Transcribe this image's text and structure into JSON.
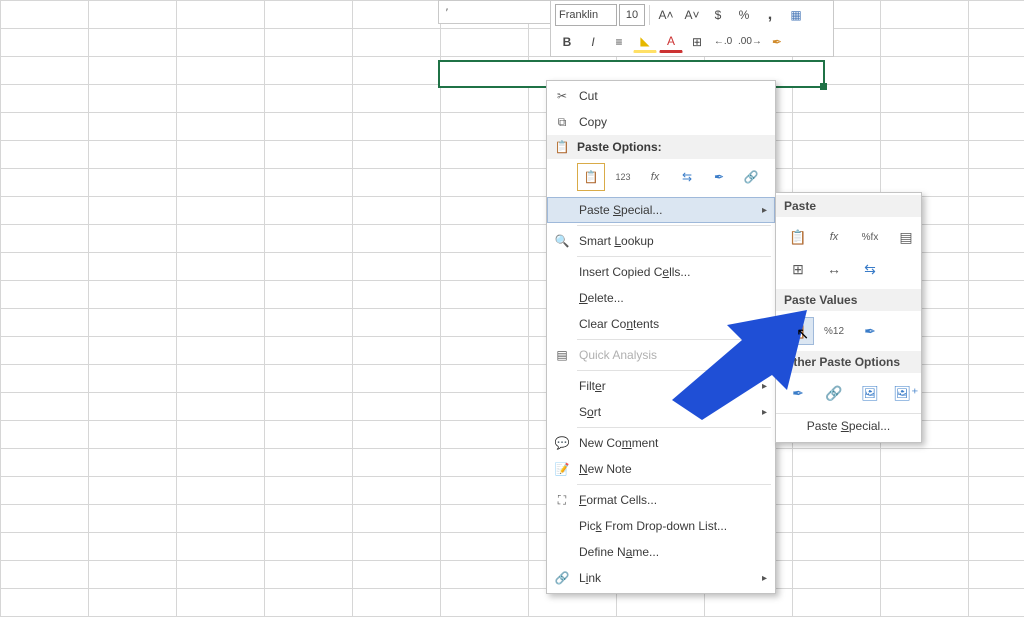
{
  "edit_cell_value": "'",
  "mini_toolbar": {
    "font_name": "Franklin",
    "font_size": "10",
    "buttons": {
      "inc_font": "A˄",
      "dec_font": "A˅",
      "currency": "$",
      "percent": "%",
      "comma": ",",
      "borders": "▦",
      "bold": "B",
      "italic": "I",
      "align": "≡",
      "fill": "◣",
      "font_color": "A",
      "merge": "⊞",
      "inc_dec": "←.0",
      "dec_dec": ".00→",
      "fmt_painter": "✒"
    }
  },
  "context_menu": {
    "cut": "Cut",
    "copy": "Copy",
    "paste_options_hdr": "Paste Options:",
    "paste_icons": {
      "default": "📋",
      "values": "123",
      "formulas": "fx",
      "transpose": "⇆",
      "formatting": "✒",
      "link": "🔗"
    },
    "paste_special": "Paste Special...",
    "smart_lookup": "Smart Lookup",
    "insert_copied": "Insert Copied Cells...",
    "delete": "Delete...",
    "clear_contents": "Clear Contents",
    "quick_analysis": "Quick Analysis",
    "filter": "Filter",
    "sort": "Sort",
    "new_comment": "New Comment",
    "new_note": "New Note",
    "format_cells": "Format Cells...",
    "pick_list": "Pick From Drop-down List...",
    "define_name": "Define Name...",
    "link": "Link"
  },
  "paste_submenu": {
    "hdr_paste": "Paste",
    "hdr_values": "Paste Values",
    "hdr_other": "Other Paste Options",
    "footer": "Paste Special...",
    "icons_paste": {
      "all": "📋",
      "formulas": "fx",
      "formulas_num": "%fx",
      "source_fmt": "▤",
      "no_borders": "⊞",
      "col_width": "↔",
      "transpose": "⇆"
    },
    "icons_values": {
      "values": "📋",
      "values_num": "%12",
      "values_fmt": "✒"
    },
    "icons_other": {
      "formatting": "✒",
      "link": "🔗",
      "picture": "🖼",
      "linked_pic": "🖼⁺"
    }
  }
}
